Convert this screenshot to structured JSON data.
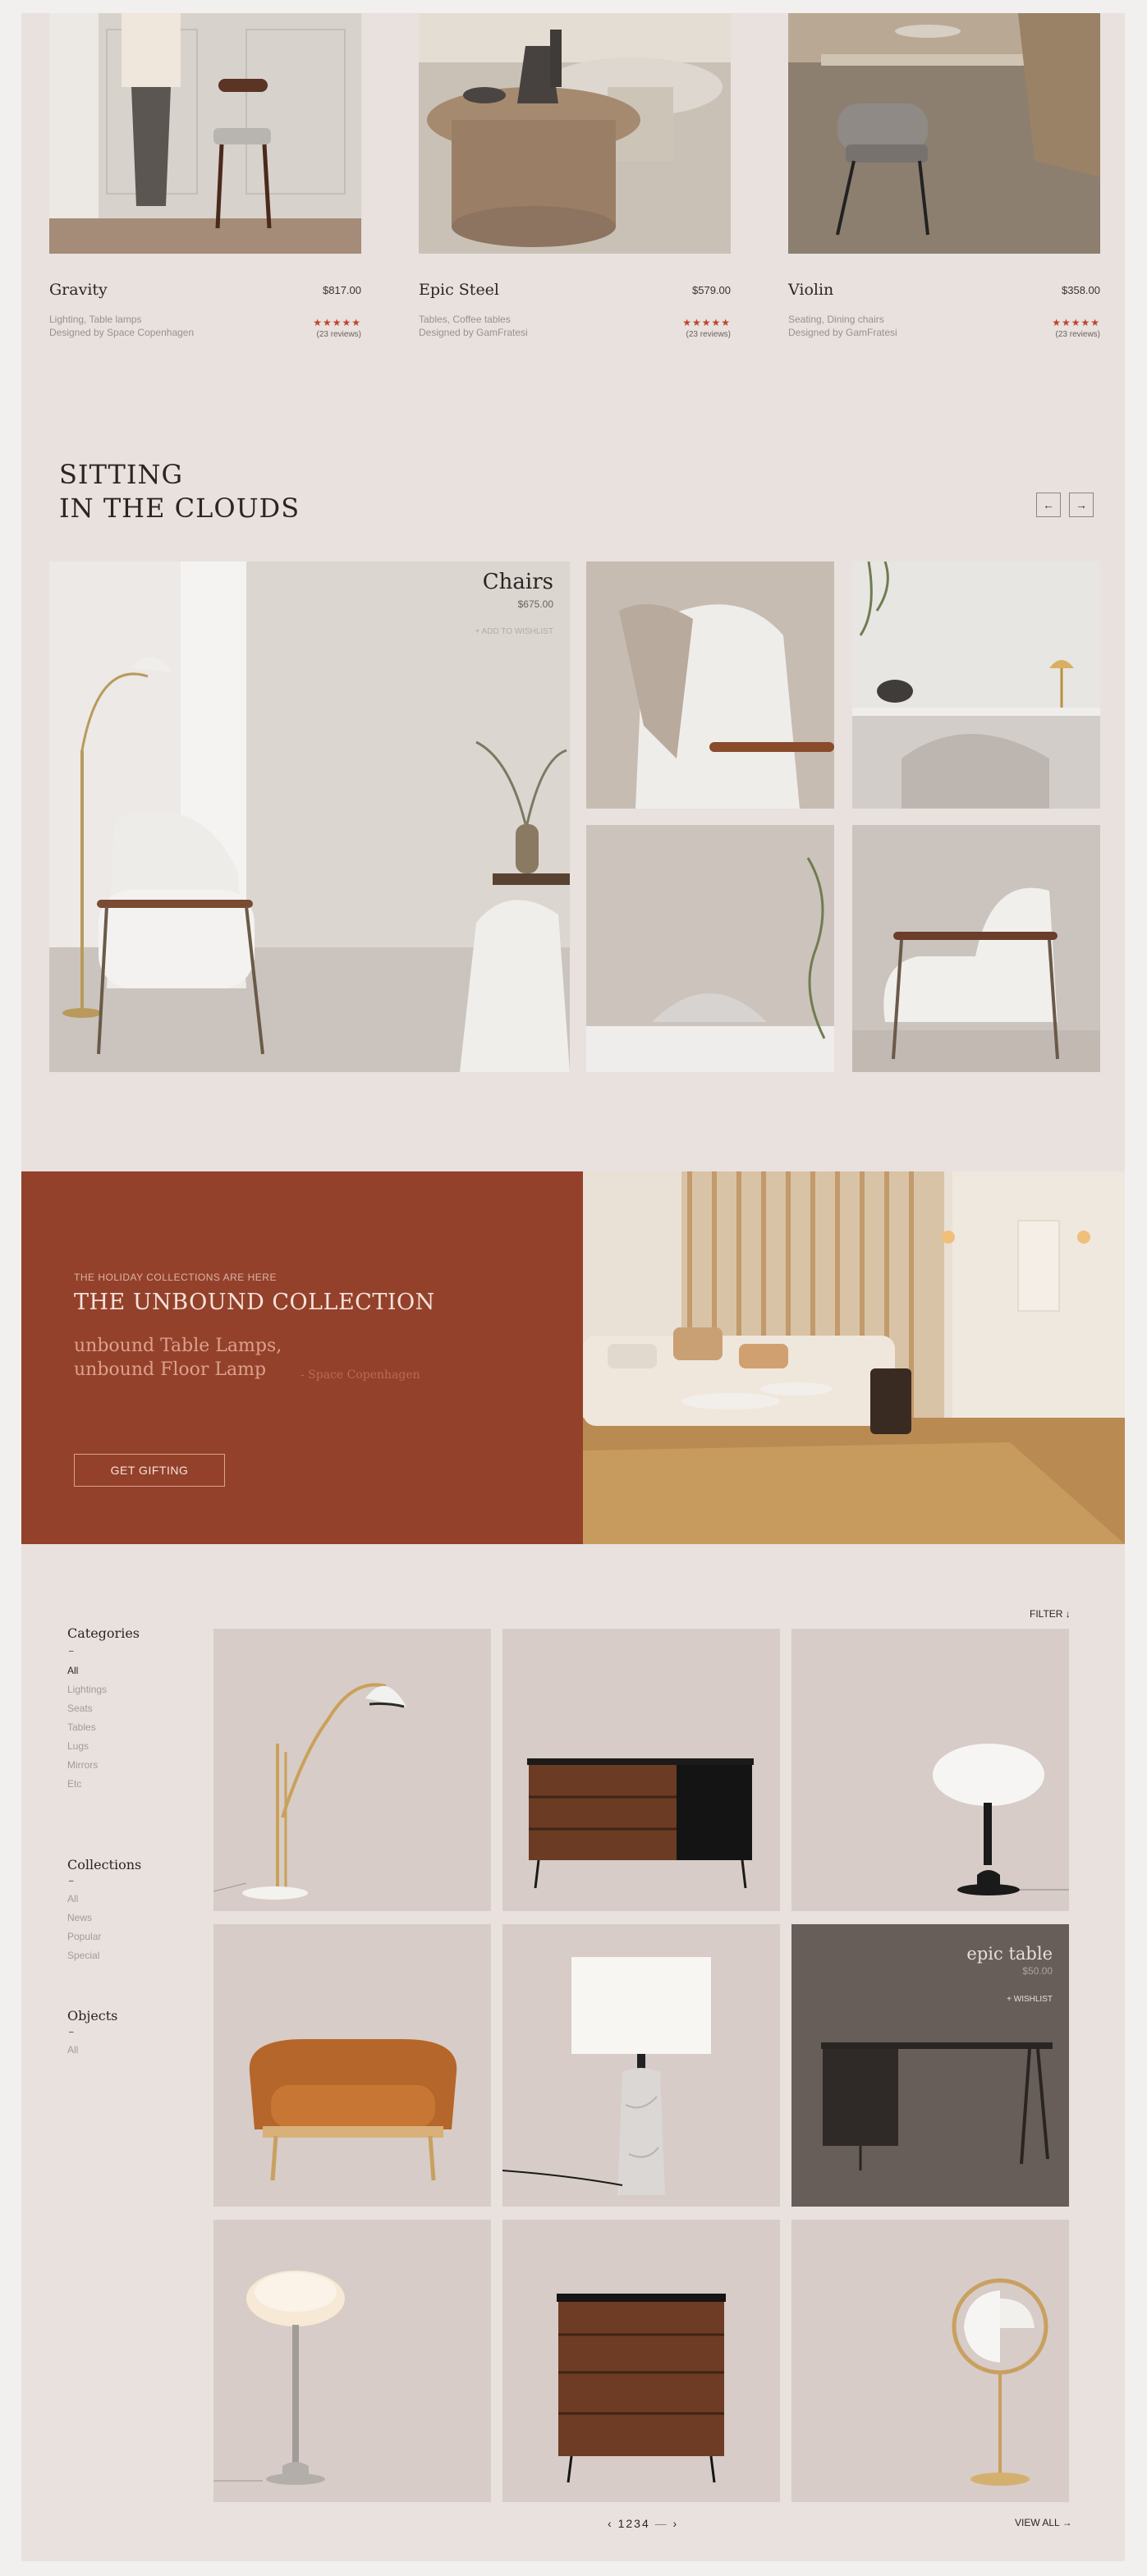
{
  "top_products": [
    {
      "name": "Gravity",
      "price": "$817.00",
      "category": "Lighting, Table lamps",
      "designer": "Designed by Space Copenhagen",
      "stars": "★★★★★",
      "reviews": "(23 reviews)",
      "rating": 5
    },
    {
      "name": "Epic Steel",
      "price": "$579.00",
      "category": "Tables, Coffee tables",
      "designer": "Designed by GamFratesi",
      "stars": "★★★★★",
      "reviews": "(23 reviews)",
      "rating": 5
    },
    {
      "name": "Violin",
      "price": "$358.00",
      "category": "Seating, Dining chairs",
      "designer": "Designed by GamFratesi",
      "stars": "★★★★★",
      "reviews": "(23 reviews)",
      "rating": 5
    }
  ],
  "section": {
    "title_line1": "SITTING",
    "title_line2": "IN THE CLOUDS",
    "prev_icon": "←",
    "next_icon": "→"
  },
  "feature": {
    "title": "Chairs",
    "price": "$675.00",
    "wishlist": "+ ADD TO WISHLIST"
  },
  "promo": {
    "kicker": "THE HOLIDAY COLLECTIONS ARE HERE",
    "title": "THE UNBOUND COLLECTION",
    "subtitle_line1": "unbound Table Lamps,",
    "subtitle_line2": "unbound Floor Lamp",
    "designer": "- Space Copenhagen",
    "button": "GET GIFTING"
  },
  "sidebar": {
    "categories": {
      "heading": "Categories",
      "dash": "–",
      "items": [
        "All",
        "Lightings",
        "Seats",
        "Tables",
        "Lugs",
        "Mirrors",
        "Etc"
      ]
    },
    "collections": {
      "heading": "Collections",
      "dash": "–",
      "items": [
        "All",
        "News",
        "Popular",
        "Special"
      ]
    },
    "objects": {
      "heading": "Objects",
      "dash": "–",
      "items": [
        "All"
      ]
    }
  },
  "catalog": {
    "filter": "FILTER ↓",
    "highlight": {
      "title": "epic table",
      "price": "$50.00",
      "wishlist": "+ WISHLIST"
    },
    "pagination": {
      "prev": "‹",
      "pages": [
        "1",
        "2",
        "3",
        "4"
      ],
      "ellipsis": "—",
      "next": "›"
    },
    "view_all": "VIEW ALL  →"
  },
  "colors": {
    "page_bg": "#e8e1de",
    "promo_bg": "#94412b",
    "star": "#c0432b",
    "tile_bg": "#d7ccc7",
    "tile_dark": "#675e59"
  }
}
